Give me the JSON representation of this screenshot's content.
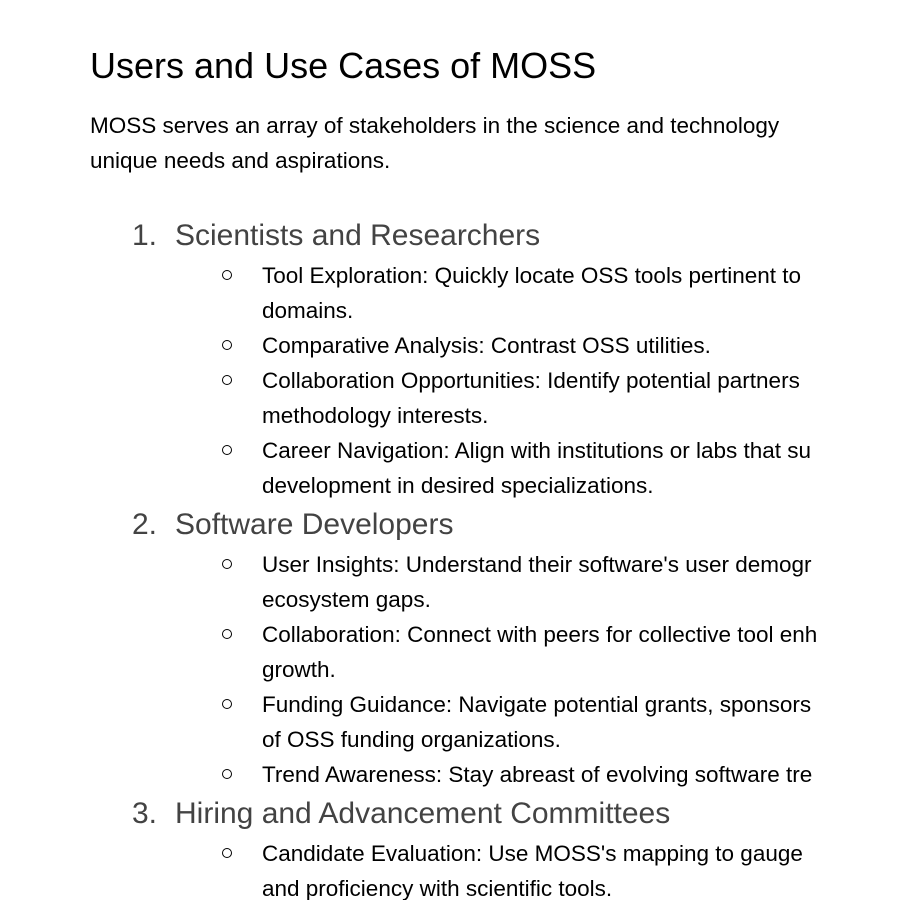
{
  "document": {
    "title": "Users and Use Cases of MOSS",
    "intro_lines": [
      "MOSS serves an array of stakeholders in the science and technology",
      "unique needs and aspirations."
    ],
    "sections": [
      {
        "number": "1.",
        "title": "Scientists and Researchers",
        "items": [
          {
            "lines": [
              "Tool Exploration: Quickly locate OSS tools pertinent to",
              "domains."
            ]
          },
          {
            "lines": [
              "Comparative Analysis: Contrast OSS utilities."
            ]
          },
          {
            "lines": [
              "Collaboration Opportunities: Identify potential partners",
              "methodology interests."
            ]
          },
          {
            "lines": [
              "Career Navigation: Align with institutions or labs that su",
              "development in desired specializations."
            ]
          }
        ]
      },
      {
        "number": "2.",
        "title": "Software Developers",
        "items": [
          {
            "lines": [
              "User Insights: Understand their software's user demogr",
              "ecosystem gaps."
            ]
          },
          {
            "lines": [
              "Collaboration: Connect with peers for collective tool enh",
              "growth."
            ]
          },
          {
            "lines": [
              "Funding Guidance: Navigate potential grants, sponsors",
              "of OSS funding organizations."
            ]
          },
          {
            "lines": [
              "Trend Awareness: Stay abreast of evolving software tre"
            ]
          }
        ]
      },
      {
        "number": "3.",
        "title": "Hiring and Advancement Committees",
        "items": [
          {
            "lines": [
              "Candidate Evaluation: Use MOSS's mapping to gauge",
              "and proficiency with scientific tools."
            ]
          }
        ]
      }
    ]
  }
}
